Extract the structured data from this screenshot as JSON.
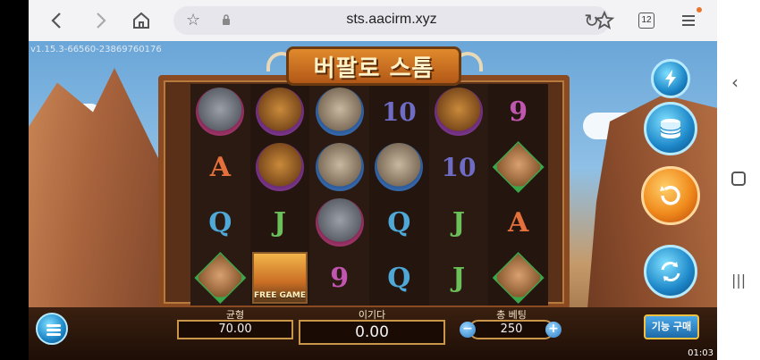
{
  "browser": {
    "url": "sts.aacirm.xyz",
    "tab_count": "12"
  },
  "game": {
    "version": "v1.15.3-66560-23869760176",
    "title": "버팔로 스톰",
    "reels": [
      [
        "wolf",
        "A",
        "Q",
        "deer"
      ],
      [
        "buffalo",
        "buffalo",
        "J",
        "free_game"
      ],
      [
        "cougar",
        "cougar",
        "wolf",
        "9"
      ],
      [
        "10",
        "cougar",
        "Q",
        "Q"
      ],
      [
        "buffalo",
        "10",
        "J",
        "J"
      ],
      [
        "9",
        "deer",
        "A",
        "deer"
      ]
    ],
    "free_game_label": "FREE GAME",
    "balance_label": "균형",
    "balance_value": "70.00",
    "win_label": "이기다",
    "win_value": "0.00",
    "bet_label": "총 베팅",
    "bet_value": "250",
    "minus": "−",
    "plus": "+",
    "feature_label": "기능 구매",
    "clock": "01:03"
  },
  "icons": [
    "back-icon",
    "forward-icon",
    "home-icon",
    "star-icon",
    "lock-icon",
    "reload-icon",
    "bookmark-star-icon",
    "tabs-icon",
    "menu-icon",
    "lightning-icon",
    "coins-icon",
    "spin-icon",
    "autoplay-icon",
    "hamburger-icon"
  ]
}
